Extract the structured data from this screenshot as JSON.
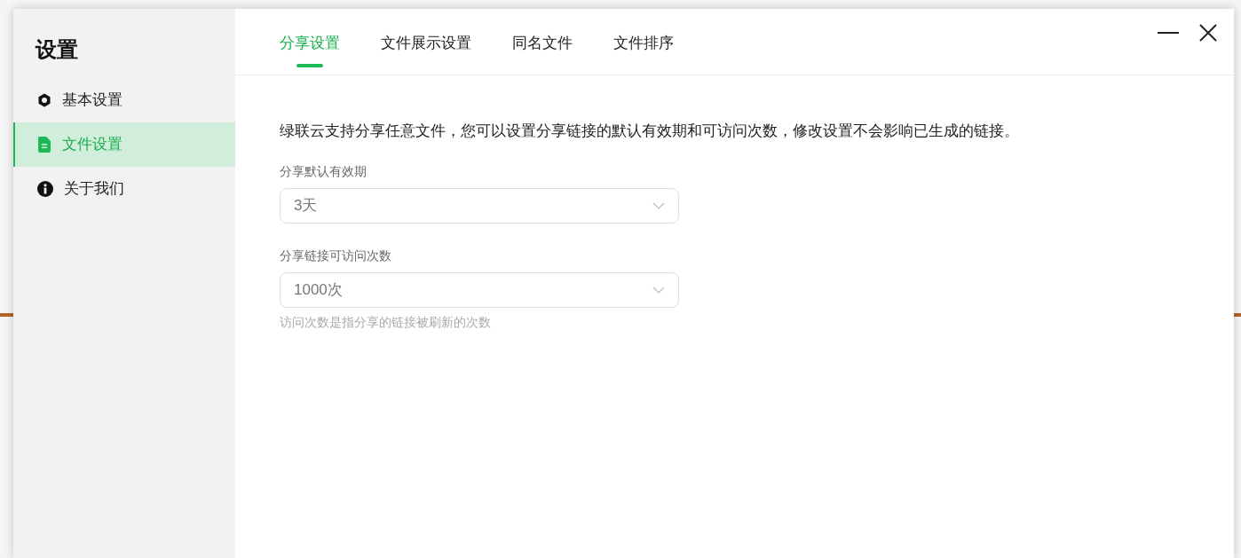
{
  "sidebar": {
    "title": "设置",
    "items": [
      {
        "label": "基本设置",
        "selected": false
      },
      {
        "label": "文件设置",
        "selected": true
      },
      {
        "label": "关于我们",
        "selected": false
      }
    ]
  },
  "tabs": [
    {
      "label": "分享设置",
      "selected": true
    },
    {
      "label": "文件展示设置",
      "selected": false
    },
    {
      "label": "同名文件",
      "selected": false
    },
    {
      "label": "文件排序",
      "selected": false
    }
  ],
  "description": "绿联云支持分享任意文件，您可以设置分享链接的默认有效期和可访问次数，修改设置不会影响已生成的链接。",
  "fields": [
    {
      "label": "分享默认有效期",
      "value": "3天"
    },
    {
      "label": "分享链接可访问次数",
      "value": "1000次",
      "hint": "访问次数是指分享的链接被刷新的次数"
    }
  ]
}
